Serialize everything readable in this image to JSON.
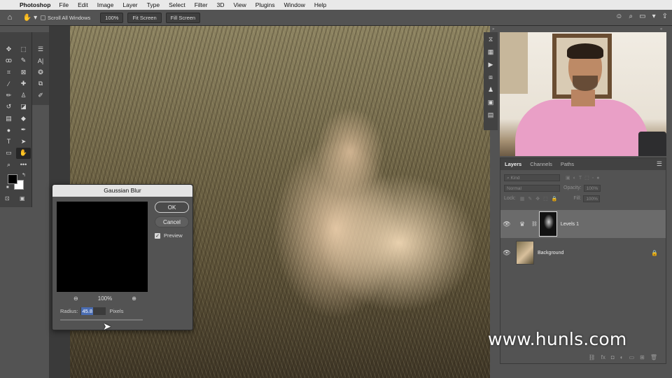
{
  "menubar": {
    "app_name": "Photoshop",
    "menus": [
      "File",
      "Edit",
      "Image",
      "Layer",
      "Type",
      "Select",
      "Filter",
      "3D",
      "View",
      "Plugins",
      "Window",
      "Help"
    ]
  },
  "options_bar": {
    "scroll_all_windows": "Scroll All Windows",
    "zoom": "100%",
    "fit_screen": "Fit Screen",
    "fill_screen": "Fill Screen"
  },
  "gaussian_blur": {
    "title": "Gaussian Blur",
    "ok": "OK",
    "cancel": "Cancel",
    "preview": "Preview",
    "preview_checked": true,
    "zoom": "100%",
    "radius_label": "Radius:",
    "radius_value": "45.8",
    "radius_unit": "Pixels"
  },
  "layers_panel": {
    "tabs": [
      "Layers",
      "Channels",
      "Paths"
    ],
    "active_tab": "Layers",
    "filter_kind": "Kind",
    "blend_mode": "Normal",
    "opacity_label": "Opacity:",
    "opacity_value": "100%",
    "fill_label": "Fill:",
    "fill_value": "100%",
    "lock_label": "Lock:",
    "layers": [
      {
        "name": "Levels 1",
        "selected": true
      },
      {
        "name": "Background",
        "locked": true
      }
    ]
  },
  "watermark": "www.hunls.com",
  "colors": {
    "ui_panel": "#535353",
    "ui_dark": "#424242",
    "selection_blue": "#4a6db3",
    "foreground_color": "#000000",
    "background_color": "#ffffff"
  }
}
